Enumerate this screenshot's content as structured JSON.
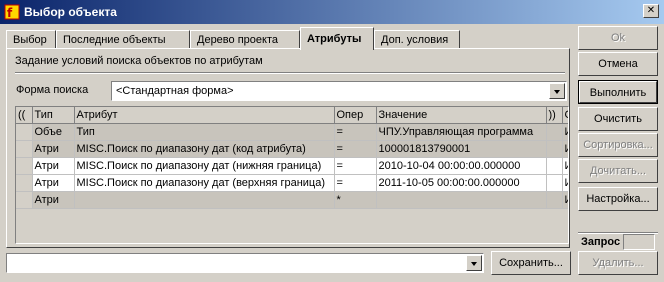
{
  "window": {
    "title": "Выбор объекта",
    "close": "✕"
  },
  "tabs": [
    {
      "label": "Выбор"
    },
    {
      "label": "Последние объекты"
    },
    {
      "label": "Дерево проекта"
    },
    {
      "label": "Атрибуты"
    },
    {
      "label": "Доп. условия"
    }
  ],
  "active_tab": "Атрибуты",
  "panel": {
    "header": "Задание условий поиска объектов по атрибутам",
    "form_label": "Форма поиска",
    "form_value": "<Стандартная форма>"
  },
  "grid": {
    "columns": [
      "((",
      "Тип",
      "Атрибут",
      "Опер",
      "Значение",
      "))",
      "С"
    ],
    "rows": [
      {
        "paren_open": "",
        "type": "Объе",
        "attribute": "Тип",
        "op": "=",
        "value": "ЧПУ.Управляющая программа",
        "paren_close": "",
        "conj": "И"
      },
      {
        "paren_open": "",
        "type": "Атри",
        "attribute": "MISC.Поиск по диапазону дат (код атрибута)",
        "op": "=",
        "value": "100001813790001",
        "paren_close": "",
        "conj": "И"
      },
      {
        "paren_open": "",
        "type": "Атри",
        "attribute": "MISC.Поиск по диапазону дат (нижняя граница)",
        "op": "=",
        "value": "2010-10-04 00:00:00.000000",
        "paren_close": "",
        "conj": "И"
      },
      {
        "paren_open": "",
        "type": "Атри",
        "attribute": "MISC.Поиск по диапазону дат (верхняя граница)",
        "op": "=",
        "value": "2011-10-05 00:00:00.000000",
        "paren_close": "",
        "conj": "И"
      },
      {
        "paren_open": "",
        "type": "Атри",
        "attribute": "",
        "op": "*",
        "value": "",
        "paren_close": "",
        "conj": "И"
      }
    ]
  },
  "buttons": {
    "ok": "Ok",
    "cancel": "Отмена",
    "execute": "Выполнить",
    "clear": "Очистить",
    "sort": "Сортировка...",
    "read_more": "Дочитать...",
    "settings": "Настройка...",
    "save": "Сохранить...",
    "delete": "Удалить..."
  },
  "zapros": {
    "label": "Запрос"
  },
  "bottom_combo": {
    "value": ""
  }
}
